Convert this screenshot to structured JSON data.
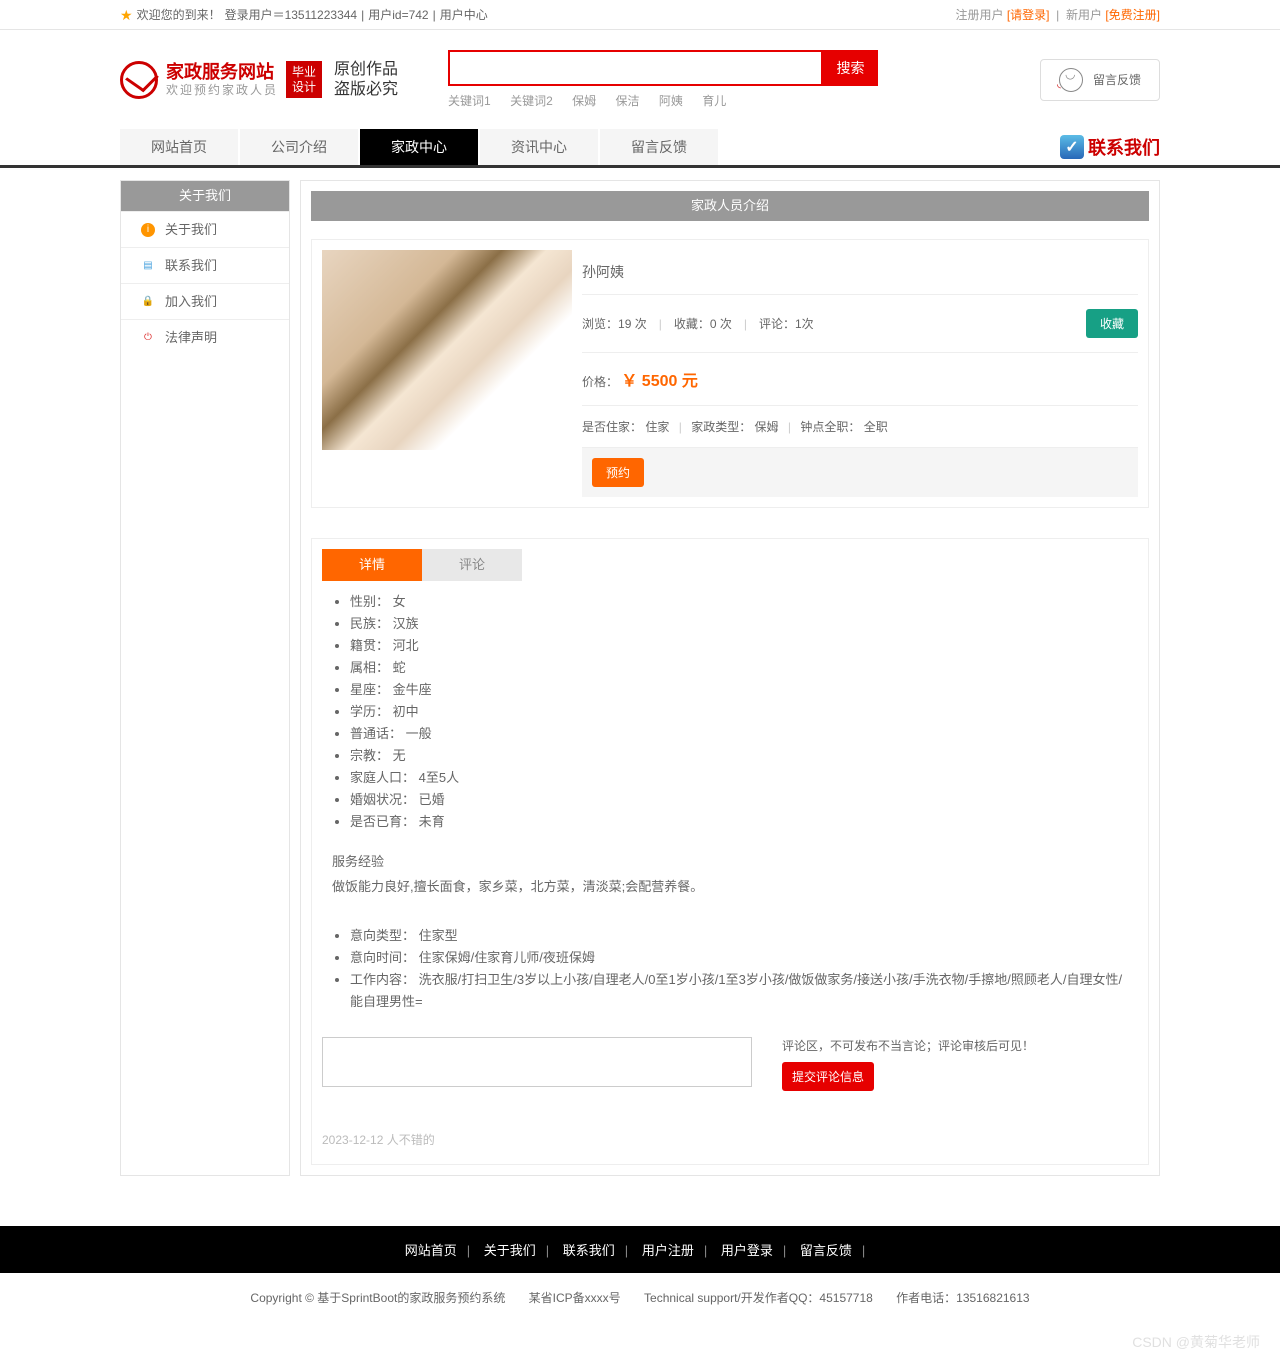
{
  "topbar": {
    "welcome": "欢迎您的到来！",
    "login_user": "登录用户＝13511223344",
    "user_id": "用户id=742",
    "user_center": "用户中心",
    "reg_user": "注册用户",
    "please_login": "[请登录]",
    "new_user": "新用户",
    "free_reg": "[免费注册]"
  },
  "header": {
    "site_title": "家政服务网站",
    "site_sub": "欢迎预约家政人员",
    "badge": "毕业\n设计",
    "sub1": "原创作品",
    "sub2": "盗版必究",
    "search_btn": "搜索",
    "keywords": [
      "关键词1",
      "关键词2",
      "保姆",
      "保洁",
      "阿姨",
      "育儿"
    ],
    "feedback": "留言反馈"
  },
  "nav": {
    "items": [
      "网站首页",
      "公司介绍",
      "家政中心",
      "资讯中心",
      "留言反馈"
    ],
    "active_index": 2,
    "contact": "联系我们"
  },
  "sidebar": {
    "title": "关于我们",
    "items": [
      "关于我们",
      "联系我们",
      "加入我们",
      "法律声明"
    ]
  },
  "content": {
    "title": "家政人员介绍",
    "name": "孙阿姨",
    "views_label": "浏览：",
    "views_val": "19 次",
    "fav_count_label": "收藏：",
    "fav_count_val": "0 次",
    "comment_label": "评论：",
    "comment_val": "1次",
    "fav_btn": "收藏",
    "price_label": "价格：",
    "price_val": "￥ 5500 元",
    "attr1_label": "是否住家：",
    "attr1_val": "住家",
    "attr2_label": "家政类型：",
    "attr2_val": "保姆",
    "attr3_label": "钟点全职：",
    "attr3_val": "全职",
    "book_btn": "预约"
  },
  "tabs": {
    "tab_detail": "详情",
    "tab_comment": "评论",
    "details": [
      "性别：  女",
      "民族：  汉族",
      "籍贯：  河北",
      "属相：  蛇",
      "星座：  金牛座",
      "学历：  初中",
      "普通话：  一般",
      "宗教：  无",
      "家庭人口：  4至5人",
      "婚姻状况：  已婚",
      "是否已育：  未育"
    ],
    "exp_title": "服务经验",
    "exp_text": "做饭能力良好,擅长面食，家乡菜，北方菜，清淡菜;会配营养餐。",
    "intent": [
      "意向类型：  住家型",
      "意向时间：  住家保姆/住家育儿师/夜班保姆",
      "工作内容：  洗衣服/打扫卫生/3岁以上小孩/自理老人/0至1岁小孩/1至3岁小孩/做饭做家务/接送小孩/手洗衣物/手擦地/照顾老人/自理女性/能自理男性="
    ],
    "comment_tip": "评论区，不可发布不当言论；评论审核后可见！",
    "submit_btn": "提交评论信息",
    "comment_entry": "2023-12-12 人不错的"
  },
  "footer": {
    "links": [
      "网站首页",
      "关于我们",
      "联系我们",
      "用户注册",
      "用户登录",
      "留言反馈"
    ],
    "copy1": "Copyright © 基于SprintBoot的家政服务预约系统",
    "copy2": "某省ICP备xxxx号",
    "copy3": "Technical support/开发作者QQ：45157718",
    "copy4": "作者电话：13516821613"
  },
  "watermark": "CSDN @黄菊华老师"
}
